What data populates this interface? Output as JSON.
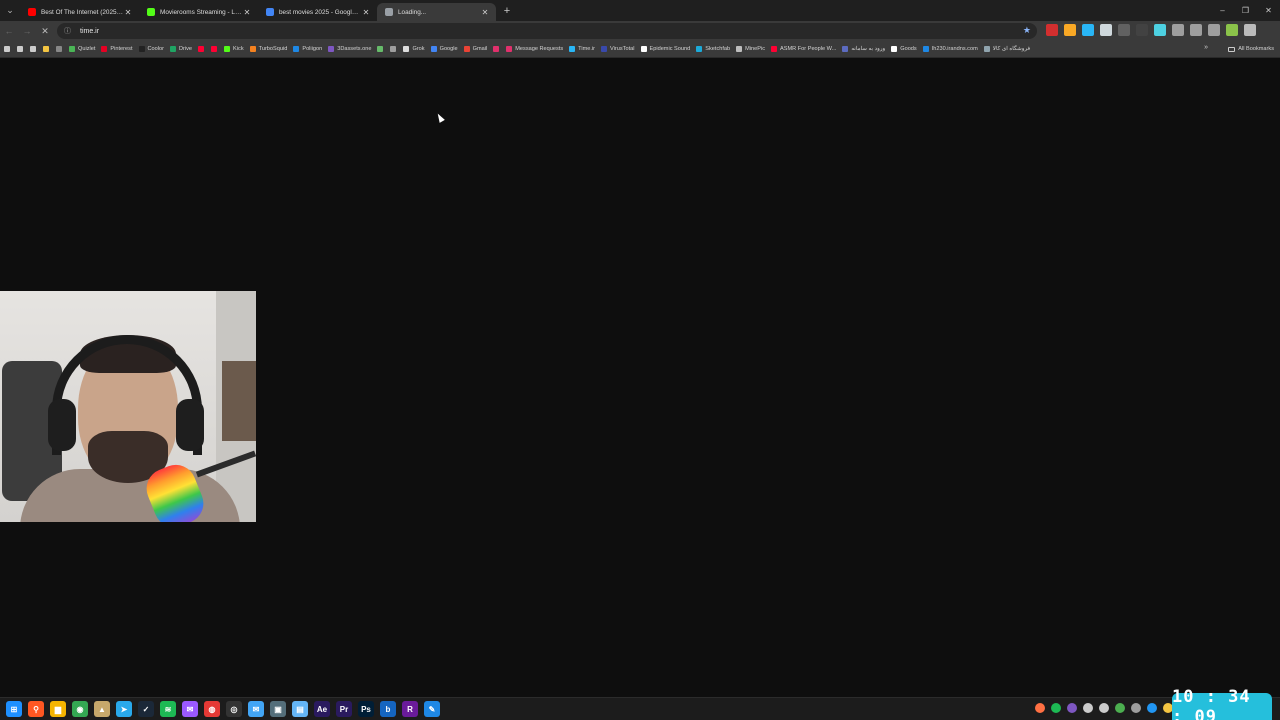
{
  "browser": {
    "tabs": [
      {
        "label": "Best Of The Internet (2025) - Yo",
        "favicon": "youtube-icon",
        "color": "#ff0000",
        "active": false
      },
      {
        "label": "Movierooms Streaming - Live S",
        "favicon": "kick-icon",
        "color": "#53fc18",
        "active": false
      },
      {
        "label": "best movies 2025 - Google Sea",
        "favicon": "google-icon",
        "color": "#4285f4",
        "active": false
      },
      {
        "label": "Loading...",
        "favicon": "loading-icon",
        "color": "#9aa0a6",
        "active": true
      }
    ],
    "new_tab_symbol": "+",
    "window_controls": {
      "minimize": "–",
      "restore": "❐",
      "close": "✕"
    },
    "url": "time.ir",
    "bookmarks": [
      {
        "label": "",
        "color": "#cccccc"
      },
      {
        "label": "",
        "color": "#cccccc"
      },
      {
        "label": "",
        "color": "#cccccc"
      },
      {
        "label": "",
        "color": "#f4c542"
      },
      {
        "label": "",
        "color": "#888888"
      },
      {
        "label": "Quizlet",
        "color": "#4ab556"
      },
      {
        "label": "Pinterest",
        "color": "#e60023"
      },
      {
        "label": "Coolor",
        "color": "#222222"
      },
      {
        "label": "Drive",
        "color": "#1fa463"
      },
      {
        "label": "",
        "color": "#ff0033"
      },
      {
        "label": "",
        "color": "#ff0033"
      },
      {
        "label": "Kick",
        "color": "#53fc18"
      },
      {
        "label": "TurboSquid",
        "color": "#f58220"
      },
      {
        "label": "Poliigon",
        "color": "#1e88e5"
      },
      {
        "label": "3Dassets.one",
        "color": "#7e57c2"
      },
      {
        "label": "",
        "color": "#66bb6a"
      },
      {
        "label": "",
        "color": "#9e9e9e"
      },
      {
        "label": "Grok",
        "color": "#dddddd"
      },
      {
        "label": "Google",
        "color": "#4285f4"
      },
      {
        "label": "Gmail",
        "color": "#ea4335"
      },
      {
        "label": "",
        "color": "#e1306c"
      },
      {
        "label": "Message Requests",
        "color": "#e1306c"
      },
      {
        "label": "Time.ir",
        "color": "#29b6f6"
      },
      {
        "label": "VirusTotal",
        "color": "#3949ab"
      },
      {
        "label": "Epidemic Sound",
        "color": "#ffffff"
      },
      {
        "label": "Sketchfab",
        "color": "#1caad9"
      },
      {
        "label": "MinePic",
        "color": "#bdbdbd"
      },
      {
        "label": "ASMR For People W...",
        "color": "#ff0033"
      },
      {
        "label": "ورود به سامانه",
        "color": "#5c6bc0"
      },
      {
        "label": "Goods",
        "color": "#ffffff"
      },
      {
        "label": "Ih230.irandns.com",
        "color": "#1e88e5"
      },
      {
        "label": "فروشگاه ای کالا",
        "color": "#90a4ae"
      }
    ],
    "more_bookmarks_symbol": "»",
    "all_bookmarks_label": "All Bookmarks"
  },
  "extensions": [
    {
      "icon": "ext-red-icon",
      "color": "#d32f2f"
    },
    {
      "icon": "ext-multi-icon",
      "color": "#f9a825"
    },
    {
      "icon": "ext-audio-icon",
      "color": "#29b6f6"
    },
    {
      "icon": "ext-shield-icon",
      "color": "#cfd8dc"
    },
    {
      "icon": "ext-grey-icon",
      "color": "#616161"
    },
    {
      "icon": "ext-dark-icon",
      "color": "#424242"
    },
    {
      "icon": "ext-teal-icon",
      "color": "#4dd0e1"
    },
    {
      "icon": "puzzle-icon",
      "color": "#9e9e9e"
    },
    {
      "icon": "key-icon",
      "color": "#9e9e9e"
    },
    {
      "icon": "media-icon",
      "color": "#9e9e9e"
    },
    {
      "icon": "profile-icon",
      "color": "#8bc34a"
    },
    {
      "icon": "menu-dots-icon",
      "color": "#bbbbbb"
    }
  ],
  "taskbar": {
    "apps": [
      {
        "name": "windows-start-icon",
        "color": "#1e90ff",
        "glyph": "⊞"
      },
      {
        "name": "search-icon",
        "color": "#ff5722",
        "glyph": "⚲"
      },
      {
        "name": "file-explorer-icon",
        "color": "#f4b400",
        "glyph": "▆"
      },
      {
        "name": "chrome-icon",
        "color": "#34a853",
        "glyph": "◉"
      },
      {
        "name": "app-icon",
        "color": "#c7a86b",
        "glyph": "▲"
      },
      {
        "name": "telegram-icon",
        "color": "#29a9eb",
        "glyph": "➤"
      },
      {
        "name": "steam-icon",
        "color": "#1b2838",
        "glyph": "✓"
      },
      {
        "name": "spotify-icon",
        "color": "#1db954",
        "glyph": "≋"
      },
      {
        "name": "messenger-icon",
        "color": "#9b59ff",
        "glyph": "✉"
      },
      {
        "name": "davinci-icon",
        "color": "#e53935",
        "glyph": "◍"
      },
      {
        "name": "github-icon",
        "color": "#333333",
        "glyph": "◎"
      },
      {
        "name": "mail-icon",
        "color": "#42a5f5",
        "glyph": "✉"
      },
      {
        "name": "capture-icon",
        "color": "#546e7a",
        "glyph": "▣"
      },
      {
        "name": "notepad-icon",
        "color": "#64b5f6",
        "glyph": "▤"
      },
      {
        "name": "after-effects-icon",
        "color": "#2a1a5e",
        "glyph": "Ae"
      },
      {
        "name": "premiere-icon",
        "color": "#2a1a5e",
        "glyph": "Pr"
      },
      {
        "name": "photoshop-icon",
        "color": "#001e36",
        "glyph": "Ps"
      },
      {
        "name": "b-app-icon",
        "color": "#1565c0",
        "glyph": "b"
      },
      {
        "name": "r-app-icon",
        "color": "#6a1b9a",
        "glyph": "R"
      },
      {
        "name": "pen-app-icon",
        "color": "#1e88e5",
        "glyph": "✎"
      }
    ],
    "tray": [
      "#ff7043",
      "#1db954",
      "#7e57c2",
      "#cccccc",
      "#cccccc",
      "#4caf50",
      "#9e9e9e",
      "#2196f3",
      "#f4c542",
      "#cccccc"
    ],
    "clock": "10 : 34 : 09",
    "clock_bg": "#25bfdc"
  }
}
